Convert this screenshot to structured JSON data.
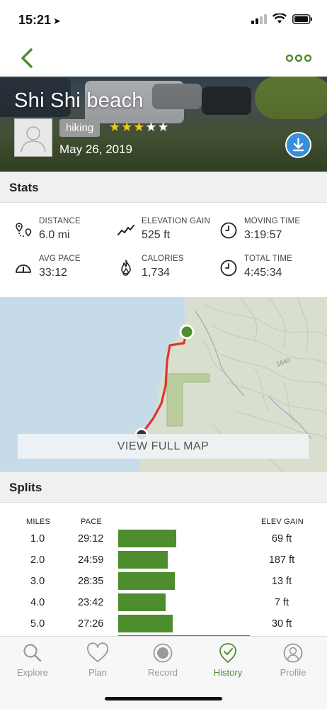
{
  "status_bar": {
    "time": "15:21",
    "location_arrow": "location-arrow-icon",
    "signal": "signal-icon",
    "wifi": "wifi-icon",
    "battery": "battery-icon"
  },
  "nav": {
    "back_icon": "chevron-left-icon",
    "more_icon": "more-dots-icon",
    "accent_color": "#4e8d2d"
  },
  "hero": {
    "title": "Shi Shi beach",
    "activity": "hiking",
    "rating": 3,
    "rating_max": 5,
    "date": "May 26, 2019",
    "download_icon": "download-icon"
  },
  "stats_section": {
    "header": "Stats",
    "items": [
      {
        "icon": "distance-icon",
        "label": "DISTANCE",
        "value": "6.0 mi"
      },
      {
        "icon": "elevation-gain-icon",
        "label": "ELEVATION GAIN",
        "value": "525 ft"
      },
      {
        "icon": "clock-icon",
        "label": "MOVING TIME",
        "value": "3:19:57"
      },
      {
        "icon": "pace-gauge-icon",
        "label": "AVG PACE",
        "value": "33:12"
      },
      {
        "icon": "flame-icon",
        "label": "CALORIES",
        "value": "1,734"
      },
      {
        "icon": "clock-icon",
        "label": "TOTAL TIME",
        "value": "4:45:34"
      }
    ]
  },
  "map": {
    "button": "VIEW FULL MAP",
    "contour_label": "1640",
    "route_color": "#e0352b",
    "start_color": "#4e8d2d"
  },
  "splits_section": {
    "header": "Splits",
    "columns": {
      "miles": "MILES",
      "pace": "PACE",
      "elev_gain": "ELEV GAIN"
    },
    "max_pace_minutes": 29.2,
    "rows": [
      {
        "mile": "1.0",
        "pace": "29:12",
        "pace_minutes": 29.2,
        "elev_gain": "69 ft"
      },
      {
        "mile": "2.0",
        "pace": "24:59",
        "pace_minutes": 24.98,
        "elev_gain": "187 ft"
      },
      {
        "mile": "3.0",
        "pace": "28:35",
        "pace_minutes": 28.58,
        "elev_gain": "13 ft"
      },
      {
        "mile": "4.0",
        "pace": "23:42",
        "pace_minutes": 23.7,
        "elev_gain": "7 ft"
      },
      {
        "mile": "5.0",
        "pace": "27:26",
        "pace_minutes": 27.43,
        "elev_gain": "30 ft"
      }
    ]
  },
  "tab_bar": {
    "tabs": [
      {
        "label": "Explore",
        "icon": "search-icon"
      },
      {
        "label": "Plan",
        "icon": "heart-icon"
      },
      {
        "label": "Record",
        "icon": "record-icon"
      },
      {
        "label": "History",
        "icon": "history-shield-icon",
        "active": true
      },
      {
        "label": "Profile",
        "icon": "profile-icon"
      }
    ]
  }
}
